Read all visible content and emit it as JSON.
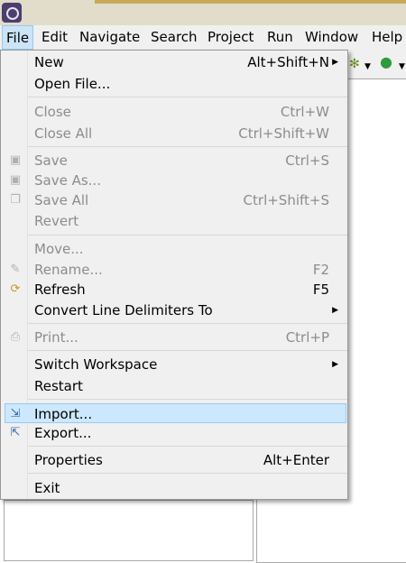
{
  "menubar": {
    "items": [
      {
        "label": "File"
      },
      {
        "label": "Edit"
      },
      {
        "label": "Navigate"
      },
      {
        "label": "Search"
      },
      {
        "label": "Project"
      },
      {
        "label": "Run"
      },
      {
        "label": "Window"
      },
      {
        "label": "Help"
      }
    ]
  },
  "file_menu": {
    "items": [
      {
        "label": "New",
        "shortcut": "Alt+Shift+N",
        "submenu": true,
        "enabled": true
      },
      {
        "label": "Open File...",
        "shortcut": "",
        "enabled": true
      },
      {
        "label": "Close",
        "shortcut": "Ctrl+W",
        "enabled": false
      },
      {
        "label": "Close All",
        "shortcut": "Ctrl+Shift+W",
        "enabled": false
      },
      {
        "label": "Save",
        "shortcut": "Ctrl+S",
        "enabled": false,
        "icon": "save-icon"
      },
      {
        "label": "Save As...",
        "shortcut": "",
        "enabled": false,
        "icon": "save-as-icon"
      },
      {
        "label": "Save All",
        "shortcut": "Ctrl+Shift+S",
        "enabled": false,
        "icon": "save-all-icon"
      },
      {
        "label": "Revert",
        "shortcut": "",
        "enabled": false
      },
      {
        "label": "Move...",
        "shortcut": "",
        "enabled": false
      },
      {
        "label": "Rename...",
        "shortcut": "F2",
        "enabled": false,
        "icon": "rename-icon"
      },
      {
        "label": "Refresh",
        "shortcut": "F5",
        "enabled": true,
        "icon": "refresh-icon"
      },
      {
        "label": "Convert Line Delimiters To",
        "shortcut": "",
        "submenu": true,
        "enabled": true
      },
      {
        "label": "Print...",
        "shortcut": "Ctrl+P",
        "enabled": false,
        "icon": "print-icon"
      },
      {
        "label": "Switch Workspace",
        "shortcut": "",
        "submenu": true,
        "enabled": true
      },
      {
        "label": "Restart",
        "shortcut": "",
        "enabled": true
      },
      {
        "label": "Import...",
        "shortcut": "",
        "enabled": true,
        "highlighted": true,
        "icon": "import-icon"
      },
      {
        "label": "Export...",
        "shortcut": "",
        "enabled": true,
        "icon": "export-icon"
      },
      {
        "label": "Properties",
        "shortcut": "Alt+Enter",
        "enabled": true
      },
      {
        "label": "Exit",
        "shortcut": "",
        "enabled": true
      }
    ]
  },
  "icons": {
    "app": "eclipse-icon",
    "toolbar": [
      "debug-icon",
      "dropdown-icon",
      "run-icon",
      "dropdown-icon"
    ]
  },
  "colors": {
    "highlight": "#cce8ff",
    "highlight_border": "#99c9ef",
    "disabled_text": "#8c8c8c",
    "menu_bg": "#f0f0f0"
  }
}
